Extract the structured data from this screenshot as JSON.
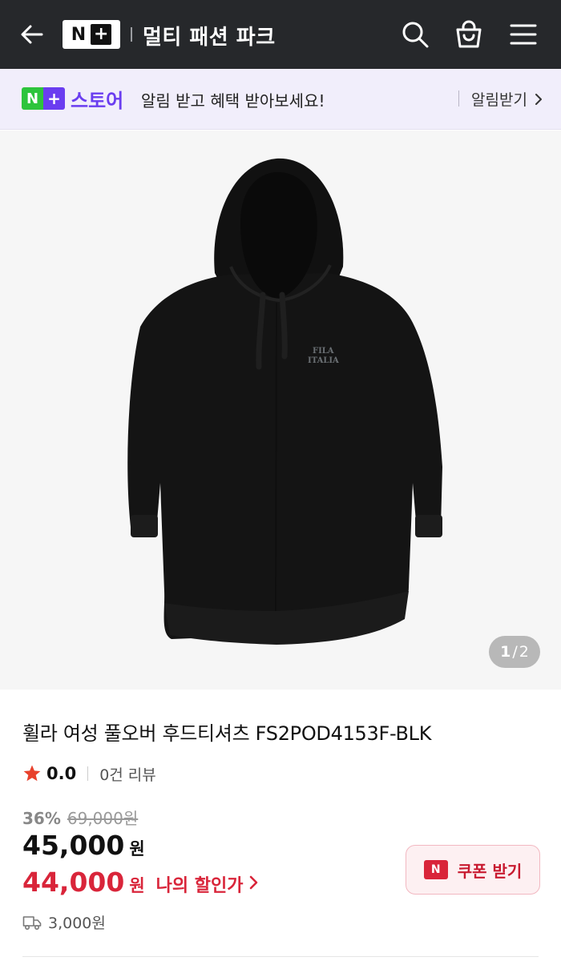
{
  "header": {
    "logo_n": "N",
    "logo_plus": "+",
    "title": "멀티 패션 파크",
    "icons": [
      "back-arrow-icon",
      "search-icon",
      "cart-icon",
      "hamburger-menu-icon"
    ]
  },
  "store_banner": {
    "badge_n": "N",
    "badge_plus": "+",
    "store_name": "스토어",
    "message": "알림 받고 혜택 받아보세요!",
    "alarm_label": "알림받기"
  },
  "product": {
    "image_counter_current": "1",
    "image_counter_sep": "/",
    "image_counter_total": "2",
    "print_line1": "FILA",
    "print_line2": "ITALIA",
    "title": "휠라 여성 풀오버 후드티셔츠 FS2POD4153F-BLK",
    "rating": "0.0",
    "review_count": "0건 리뷰",
    "discount_rate": "36%",
    "original_price": "69,000원",
    "sale_price": "45,000",
    "sale_currency": "원",
    "my_price": "44,000",
    "my_currency": "원",
    "my_price_label": "나의 할인가",
    "coupon_label": "쿠폰 받기",
    "coupon_icon_text": "N",
    "shipping_fee": "3,000원"
  },
  "colors": {
    "header_bg": "#26282b",
    "banner_bg": "#f1eefb",
    "naver_green": "#2dc43c",
    "store_purple": "#6a3df0",
    "accent_red": "#d9253a",
    "star": "#e8412c"
  }
}
